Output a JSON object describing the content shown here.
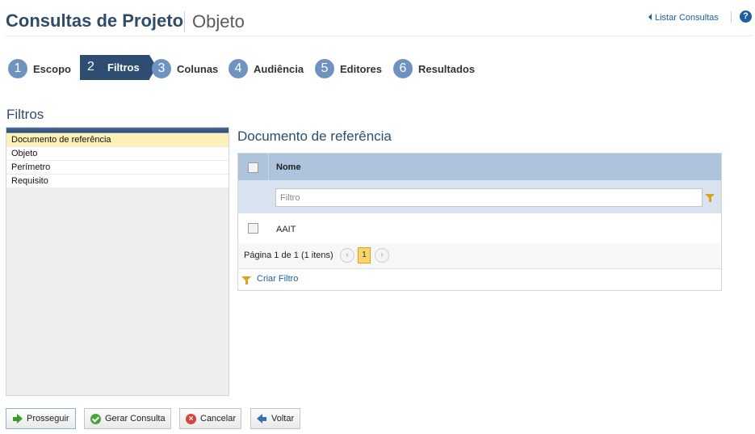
{
  "header": {
    "title": "Consultas de Projeto",
    "subtitle": "Objeto",
    "list_link": "Listar Consultas",
    "help_icon": "question-circle-icon",
    "help_glyph": "?"
  },
  "steps": [
    {
      "num": "1",
      "label": "Escopo",
      "active": false
    },
    {
      "num": "2",
      "label": "Filtros",
      "active": true
    },
    {
      "num": "3",
      "label": "Colunas",
      "active": false
    },
    {
      "num": "4",
      "label": "Audiência",
      "active": false
    },
    {
      "num": "5",
      "label": "Editores",
      "active": false
    },
    {
      "num": "6",
      "label": "Resultados",
      "active": false
    }
  ],
  "filters": {
    "title": "Filtros",
    "items": [
      {
        "label": "Documento de referência",
        "selected": true
      },
      {
        "label": "Objeto",
        "selected": false
      },
      {
        "label": "Perímetro",
        "selected": false
      },
      {
        "label": "Requisito",
        "selected": false
      }
    ]
  },
  "detail": {
    "title": "Documento de referência",
    "grid": {
      "column_name": "Nome",
      "filter_placeholder": "Filtro",
      "rows": [
        {
          "name": "AAIT",
          "checked": false
        }
      ],
      "pager": {
        "text": "Página 1 de 1 (1 itens)",
        "prev": "‹",
        "current": "1",
        "next": "›"
      },
      "create_filter": "Criar Filtro"
    }
  },
  "buttons": {
    "continue": "Prosseguir",
    "generate": "Gerar Consulta",
    "cancel": "Cancelar",
    "cancel_glyph": "×",
    "back": "Voltar"
  },
  "colors": {
    "title": "#2e4d6b",
    "active_step": "#2e4d73",
    "step_circle": "#6f93c0",
    "grid_header": "#aec3dc",
    "selected_row": "#fdf0b8",
    "link": "#1f5fa0"
  }
}
